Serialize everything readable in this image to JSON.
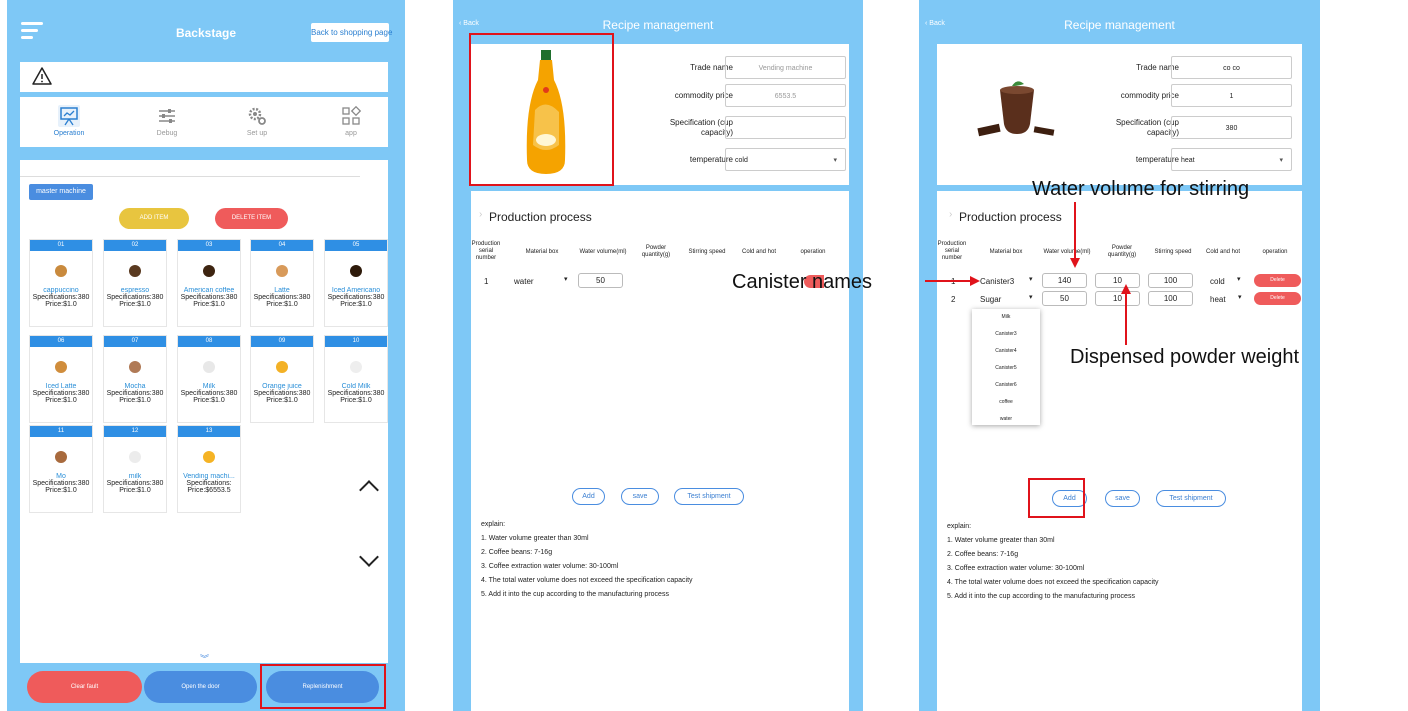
{
  "backstage": {
    "title": "Backstage",
    "shop_button": "Back to shopping page",
    "nav": [
      "Operation",
      "Debug",
      "Set up",
      "app"
    ],
    "master_label": "master machine",
    "add_item": "ADD ITEM",
    "delete_item": "DELETE ITEM",
    "products": [
      {
        "num": "01",
        "name": "cappuccino",
        "spec": "Specifications:380",
        "price": "Price:$1.0",
        "color": "#c98a3d"
      },
      {
        "num": "02",
        "name": "espresso",
        "spec": "Specifications:380",
        "price": "Price:$1.0",
        "color": "#5a3a20"
      },
      {
        "num": "03",
        "name": "American coffee",
        "spec": "Specifications:380",
        "price": "Price:$1.0",
        "color": "#3d2410"
      },
      {
        "num": "04",
        "name": "Latte",
        "spec": "Specifications:380",
        "price": "Price:$1.0",
        "color": "#d89a5a"
      },
      {
        "num": "05",
        "name": "Iced Americano",
        "spec": "Specifications:380",
        "price": "Price:$1.0",
        "color": "#2e1a0a"
      },
      {
        "num": "06",
        "name": "Iced Latte",
        "spec": "Specifications:380",
        "price": "Price:$1.0",
        "color": "#d08d3c"
      },
      {
        "num": "07",
        "name": "Mocha",
        "spec": "Specifications:380",
        "price": "Price:$1.0",
        "color": "#b07a56"
      },
      {
        "num": "08",
        "name": "Milk",
        "spec": "Specifications:380",
        "price": "Price:$1.0",
        "color": "#e8e8e8"
      },
      {
        "num": "09",
        "name": "Orange juice",
        "spec": "Specifications:380",
        "price": "Price:$1.0",
        "color": "#f3b126"
      },
      {
        "num": "10",
        "name": "Cold Milk",
        "spec": "Specifications:380",
        "price": "Price:$1.0",
        "color": "#eeeeee"
      },
      {
        "num": "11",
        "name": "Mo",
        "spec": "Specifications:380",
        "price": "Price:$1.0",
        "color": "#a86a3d"
      },
      {
        "num": "12",
        "name": "milk",
        "spec": "Specifications:380",
        "price": "Price:$1.0",
        "color": "#ececec"
      },
      {
        "num": "13",
        "name": "Vending machi...",
        "spec": "Specifications:",
        "price": "Price:$6553.5",
        "color": "#f5b324"
      }
    ],
    "clear_fault": "Clear fault",
    "open_door": "Open the door",
    "replenishment": "Replenishment"
  },
  "recipe1": {
    "back": "Back",
    "title": "Recipe management",
    "labels": {
      "trade_name": "Trade name",
      "price": "commodity price",
      "spec": "Specification (cup capacity)",
      "temperature": "temperature"
    },
    "trade_name_placeholder": "Vending machine",
    "price_placeholder": "6553.5",
    "spec_value": "",
    "temperature": "cold",
    "process_title": "Production process",
    "columns": [
      "Production serial number",
      "Material box",
      "Water volume(ml)",
      "Powder quantity(g)",
      "Stirring speed",
      "Cold and hot",
      "operation"
    ],
    "row": {
      "serial": "1",
      "material": "water",
      "water": "50"
    },
    "buttons": [
      "Add",
      "save",
      "Test shipment"
    ],
    "explain_title": "explain:",
    "explain": [
      "1. Water volume greater than 30ml",
      "2. Coffee beans: 7-16g",
      "3. Coffee extraction water volume: 30-100ml",
      "4. The total water volume does not exceed the specification capacity",
      "5. Add it into the cup according to the manufacturing process"
    ]
  },
  "recipe2": {
    "back": "Back",
    "title": "Recipe management",
    "labels": {
      "trade_name": "Trade name",
      "price": "commodity price",
      "spec": "Specification (cup capacity)",
      "temperature": "temperature"
    },
    "trade_name": "co co",
    "price": "1",
    "spec": "380",
    "temperature": "heat",
    "process_title": "Production process",
    "columns": [
      "Production serial number",
      "Material box",
      "Water volume(ml)",
      "Powder quantity(g)",
      "Stirring speed",
      "Cold and hot",
      "operation"
    ],
    "rows": [
      {
        "serial": "1",
        "material": "Canister3",
        "water": "140",
        "powder": "10",
        "speed": "100",
        "temp": "cold",
        "op": "Delete"
      },
      {
        "serial": "2",
        "material": "Sugar",
        "water": "50",
        "powder": "10",
        "speed": "100",
        "temp": "heat",
        "op": "Delete"
      }
    ],
    "dropdown": [
      "Milk",
      "Canister3",
      "Canister4",
      "Canister5",
      "Canister6",
      "coffee",
      "water"
    ],
    "buttons": [
      "Add",
      "save",
      "Test shipment"
    ],
    "explain_title": "explain:",
    "explain": [
      "1. Water volume greater than 30ml",
      "2. Coffee beans: 7-16g",
      "3. Coffee extraction water volume: 30-100ml",
      "4. The total water volume does not exceed the specification capacity",
      "5. Add it into the cup according to the manufacturing process"
    ]
  },
  "annotations": {
    "canister_names": "Canister names",
    "water_volume": "Water volume for stirring",
    "powder_weight": "Dispensed powder weight"
  }
}
